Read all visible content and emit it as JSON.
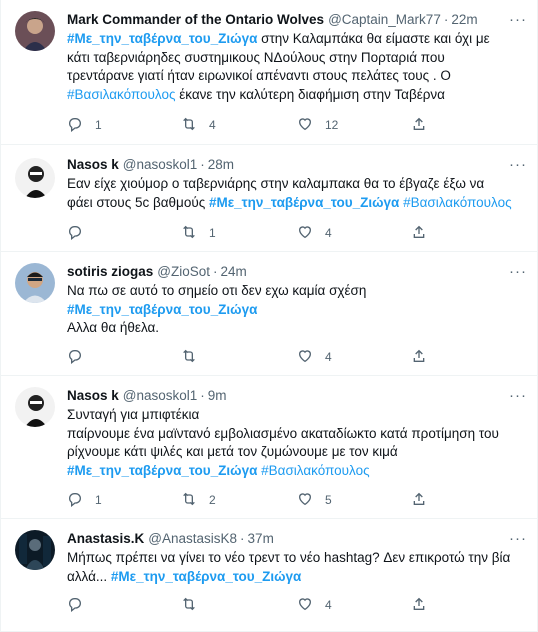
{
  "tweets": [
    {
      "name": "Mark Commander of the Ontario Wolves",
      "handle": "@Captain_Mark77",
      "time": "22m",
      "lines": [
        [
          {
            "t": "#Με_την_ταβέρνα_του_Ζιώγα",
            "tag": true,
            "bold": true
          },
          {
            "t": " στην Καλαμπάκα θα είμαστε και όχι με"
          }
        ],
        [
          {
            "t": "κάτι ταβερνιάρηδες συστημικους ΝΔούλους στην Πορταριά που"
          }
        ],
        [
          {
            "t": "τρεντάρανε γιατί ήταν ειρωνικοί απέναντι στους πελάτες τους . Ο"
          }
        ],
        [
          {
            "t": "#Βασιλακόπουλος",
            "tag": true,
            "bold": false
          },
          {
            "t": " έκανε την καλύτερη διαφήμιση στην Ταβέρνα"
          }
        ]
      ],
      "replies": "1",
      "retweets": "4",
      "likes": "12"
    },
    {
      "name": "Nasos k",
      "handle": "@nasoskol1",
      "time": "28m",
      "lines": [
        [
          {
            "t": "Εαν είχε χιούμορ ο ταβερνιάρης στην καλαμπακα  θα το έβγαζε έξω να"
          }
        ],
        [
          {
            "t": "φάει στους 5c βαθμούς "
          },
          {
            "t": "#Με_την_ταβέρνα_του_Ζιώγα",
            "tag": true,
            "bold": true
          },
          {
            "t": " "
          },
          {
            "t": "#Βασιλακόπουλος",
            "tag": true,
            "bold": false
          }
        ]
      ],
      "replies": "",
      "retweets": "1",
      "likes": "4"
    },
    {
      "name": "sotiris ziogas",
      "handle": "@ZioSot",
      "time": "24m",
      "lines": [
        [
          {
            "t": "Να πω σε αυτό το σημείο οτι δεν εχω καμία σχέση"
          }
        ],
        [
          {
            "t": "#Με_την_ταβέρνα_του_Ζιώγα",
            "tag": true,
            "bold": true
          }
        ],
        [
          {
            "t": "Αλλα θα ήθελα."
          }
        ]
      ],
      "replies": "",
      "retweets": "",
      "likes": "4"
    },
    {
      "name": "Nasos k",
      "handle": "@nasoskol1",
      "time": "9m",
      "lines": [
        [
          {
            "t": "Συνταγή για μπιφτέκια"
          }
        ],
        [
          {
            "t": "παίρνουμε ένα μαϊντανό εμβολιασμένο ακαταδίωκτο κατά προτίμηση του"
          }
        ],
        [
          {
            "t": "ρίχνουμε κάτι ψιλές και μετά τον ζυμώνουμε με τον κιμά"
          }
        ],
        [
          {
            "t": "#Με_την_ταβέρνα_του_Ζιώγα",
            "tag": true,
            "bold": true
          },
          {
            "t": " "
          },
          {
            "t": "#Βασιλακόπουλος",
            "tag": true,
            "bold": false
          }
        ]
      ],
      "replies": "1",
      "retweets": "2",
      "likes": "5"
    },
    {
      "name": "Anastasis.K",
      "handle": "@AnastasisK8",
      "time": "37m",
      "lines": [
        [
          {
            "t": "Μήπως πρέπει να γίνει το νέο τρεντ το νέο hashtag? Δεν επικροτώ την βία"
          }
        ],
        [
          {
            "t": "αλλά... "
          },
          {
            "t": "#Με_την_ταβέρνα_του_Ζιώγα",
            "tag": true,
            "bold": true
          }
        ]
      ],
      "replies": "",
      "retweets": "",
      "likes": "4"
    }
  ],
  "ui": {
    "more_glyph": "···",
    "separator": "·"
  },
  "colors": {
    "link": "#1d9bf0",
    "muted": "#536471",
    "border": "#eff3f4"
  }
}
